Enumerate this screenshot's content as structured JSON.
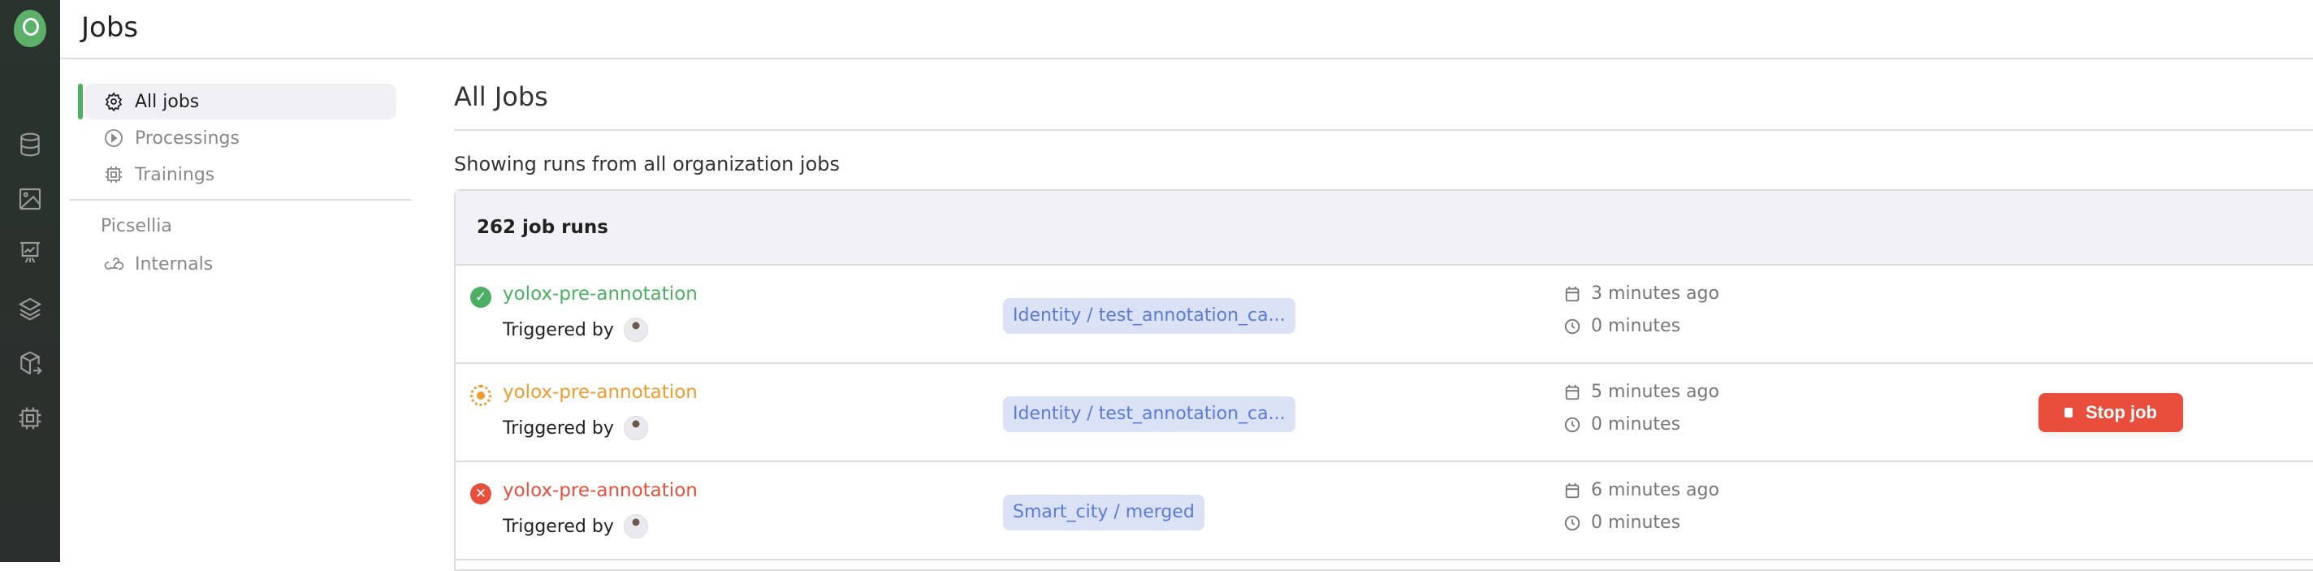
{
  "header": {
    "title": "Jobs"
  },
  "sidebar": {
    "items": [
      {
        "label": "All jobs",
        "icon": "gear-icon",
        "active": true
      },
      {
        "label": "Processings",
        "icon": "play-circle-icon"
      },
      {
        "label": "Trainings",
        "icon": "cpu-icon"
      }
    ],
    "section": "Picsellia",
    "section_items": [
      {
        "label": "Internals",
        "icon": "webhook-icon"
      }
    ]
  },
  "main": {
    "title": "All Jobs",
    "subtitle": "Showing runs from all organization jobs",
    "count": "262 job runs",
    "rows": [
      {
        "name": "yolox-pre-annotation",
        "status": "success",
        "color": "#4caf63",
        "triggered": "Triggered by",
        "tag": "Identity / test_annotation_ca...",
        "created": "3 minutes ago",
        "duration": "0 minutes"
      },
      {
        "name": "yolox-pre-annotation",
        "status": "running",
        "color": "#f29a2e",
        "triggered": "Triggered by",
        "tag": "Identity / test_annotation_ca...",
        "created": "5 minutes ago",
        "duration": "0 minutes",
        "action": "Stop job"
      },
      {
        "name": "yolox-pre-annotation",
        "status": "failed",
        "color": "#e94e3d",
        "triggered": "Triggered by",
        "tag": "Smart_city / merged",
        "created": "6 minutes ago",
        "duration": "0 minutes"
      }
    ]
  }
}
